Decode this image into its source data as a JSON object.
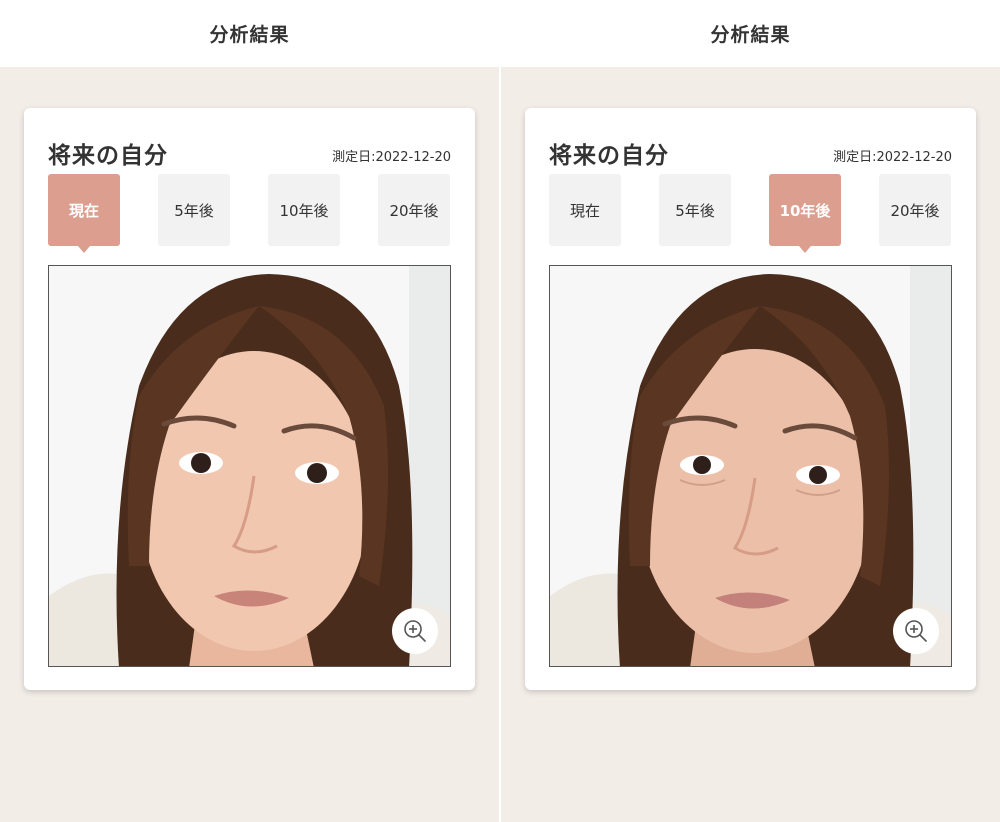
{
  "screens": [
    {
      "header": {
        "title": "分析結果"
      },
      "card": {
        "title": "将来の自分",
        "date": "測定日:2022-12-20",
        "tabs": [
          {
            "label": "現在",
            "active": true
          },
          {
            "label": "5年後",
            "active": false
          },
          {
            "label": "10年後",
            "active": false
          },
          {
            "label": "20年後",
            "active": false
          }
        ],
        "photo": {
          "icon": "face-photo"
        },
        "zoom": {
          "icon": "zoom-in-icon"
        }
      }
    },
    {
      "header": {
        "title": "分析結果"
      },
      "card": {
        "title": "将来の自分",
        "date": "測定日:2022-12-20",
        "tabs": [
          {
            "label": "現在",
            "active": false
          },
          {
            "label": "5年後",
            "active": false
          },
          {
            "label": "10年後",
            "active": true
          },
          {
            "label": "20年後",
            "active": false
          }
        ],
        "photo": {
          "icon": "face-photo"
        },
        "zoom": {
          "icon": "zoom-in-icon"
        }
      }
    }
  ],
  "colors": {
    "accent": "#dc9e8f",
    "background": "#f3ede8",
    "tab_inactive": "#f2f2f2",
    "text": "#333333"
  }
}
